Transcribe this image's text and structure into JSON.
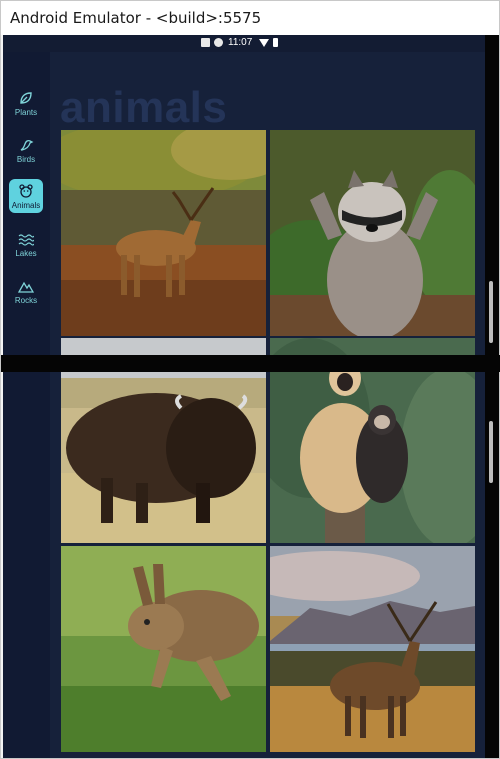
{
  "window": {
    "title": "Android Emulator - <build>:5575"
  },
  "statusbar": {
    "time": "11:07"
  },
  "nav": {
    "items": [
      {
        "label": "Plants",
        "icon": "leaf-icon",
        "active": false
      },
      {
        "label": "Birds",
        "icon": "bird-icon",
        "active": false
      },
      {
        "label": "Animals",
        "icon": "bear-face-icon",
        "active": true
      },
      {
        "label": "Lakes",
        "icon": "waves-icon",
        "active": false
      },
      {
        "label": "Rocks",
        "icon": "mountain-icon",
        "active": false
      }
    ]
  },
  "page": {
    "heading": "animals"
  },
  "gallery": {
    "images": [
      {
        "subject": "red deer stag"
      },
      {
        "subject": "raccoon"
      },
      {
        "subject": "american bison"
      },
      {
        "subject": "gibbons"
      },
      {
        "subject": "brown hare"
      },
      {
        "subject": "red deer stag in highlands"
      }
    ]
  }
}
